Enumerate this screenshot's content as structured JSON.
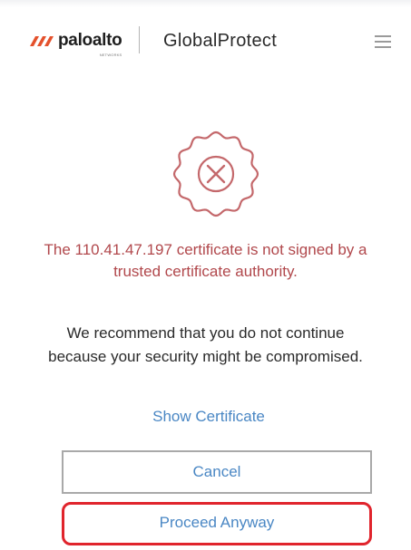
{
  "header": {
    "brand": "paloalto",
    "brand_sub": "NETWORKS",
    "product": "GlobalProtect"
  },
  "dialog": {
    "error_message": "The 110.41.47.197 certificate is not signed by a trusted certificate authority.",
    "info_message": "We recommend that you do not continue because your security might be compromised.",
    "show_certificate_link": "Show Certificate",
    "cancel_label": "Cancel",
    "proceed_label": "Proceed Anyway"
  },
  "icons": {
    "brand_logo": "paloalto-logo-icon",
    "menu": "hamburger-menu-icon",
    "error_seal": "error-x-seal-icon"
  },
  "colors": {
    "error_text": "#b1484c",
    "seal_stroke": "#c4686b",
    "link": "#4a87c4",
    "brand_orange": "#e4512c",
    "highlight": "#e0242c"
  }
}
